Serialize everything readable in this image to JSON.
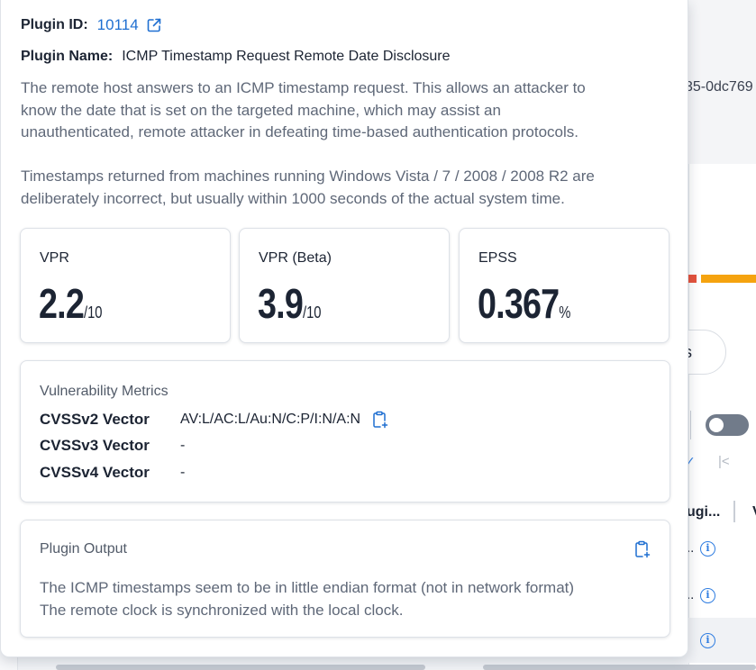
{
  "plugin": {
    "id_label": "Plugin ID:",
    "id_value": "10114",
    "name_label": "Plugin Name:",
    "name_value": "ICMP Timestamp Request Remote Date Disclosure",
    "description": "The remote host answers to an ICMP timestamp request.  This allows an attacker to\nknow the date that is set on the targeted machine, which may assist an\nunauthenticated, remote attacker in defeating time-based authentication protocols.\n\nTimestamps returned from machines running Windows Vista / 7 / 2008 / 2008 R2 are\ndeliberately incorrect, but usually within 1000 seconds of the actual system time."
  },
  "scores": [
    {
      "label": "VPR",
      "value": "2.2",
      "unit": "/10"
    },
    {
      "label": "VPR (Beta)",
      "value": "3.9",
      "unit": "/10"
    },
    {
      "label": "EPSS",
      "value": "0.367",
      "unit": "%"
    }
  ],
  "metrics": {
    "title": "Vulnerability Metrics",
    "rows": [
      {
        "key": "CVSSv2 Vector",
        "value": "AV:L/AC:L/Au:N/C:P/I:N/A:N"
      },
      {
        "key": "CVSSv3 Vector",
        "value": "-"
      },
      {
        "key": "CVSSv4 Vector",
        "value": "-"
      }
    ]
  },
  "output": {
    "title": "Plugin Output",
    "text": "The ICMP timestamps seem to be in little endian format (not in network format)\nThe remote clock is synchronized with the local clock."
  },
  "background": {
    "asset_id_fragment": "35-0dc769",
    "pill_text": "s",
    "column_header": "ugi...",
    "column_header_2": "V",
    "row_text": ".."
  },
  "colors": {
    "link": "#1f6fd1",
    "text": "#1c2433",
    "muted": "#5f6878",
    "severity_red": "#e5533d",
    "severity_orange": "#f5a30f"
  }
}
